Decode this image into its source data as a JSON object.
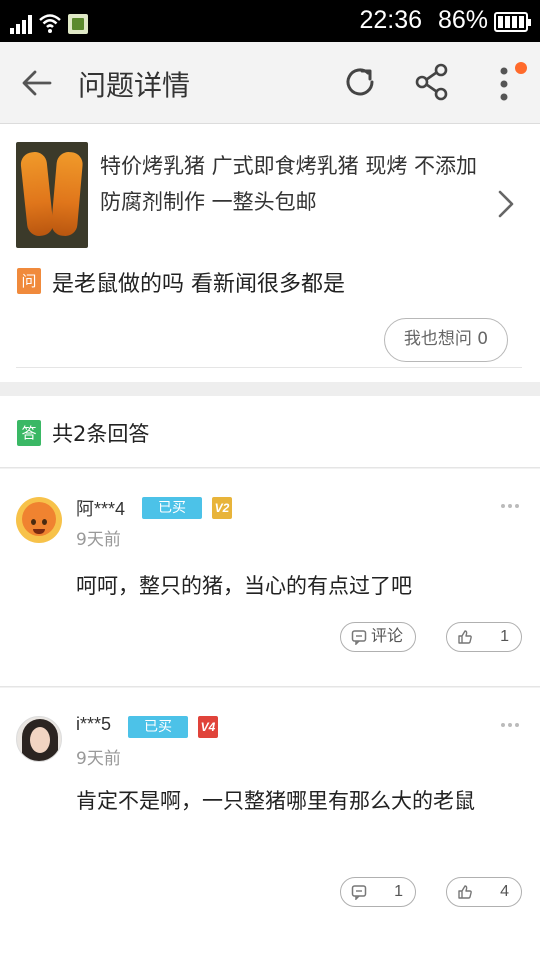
{
  "status_bar": {
    "time": "22:36",
    "battery": "86%"
  },
  "header": {
    "title": "问题详情"
  },
  "product": {
    "title": "特价烤乳猪 广式即食烤乳猪 现烤 不添加防腐剂制作 一整头包邮"
  },
  "question": {
    "badge": "问",
    "text": "是老鼠做的吗 看新闻很多都是",
    "ask_label": "我也想问 0"
  },
  "answers_header": {
    "badge": "答",
    "text": "共2条回答"
  },
  "answers": [
    {
      "user": "阿***4",
      "bought_label": "已买",
      "level": "V2",
      "time": "9天前",
      "text": "呵呵，整只的猪，当心的有点过了吧",
      "comment_label": "评论",
      "likes": "1"
    },
    {
      "user": "i***5",
      "bought_label": "已买",
      "level": "V4",
      "time": "9天前",
      "text": "肯定不是啊，一只整猪哪里有那么大的老鼠",
      "comment_label": "1",
      "likes": "4"
    }
  ],
  "colors": {
    "accent_orange": "#f08a3c",
    "answer_green": "#3ab865",
    "bought_blue": "#4cc2e8",
    "notify_dot": "#ff6a2b"
  }
}
